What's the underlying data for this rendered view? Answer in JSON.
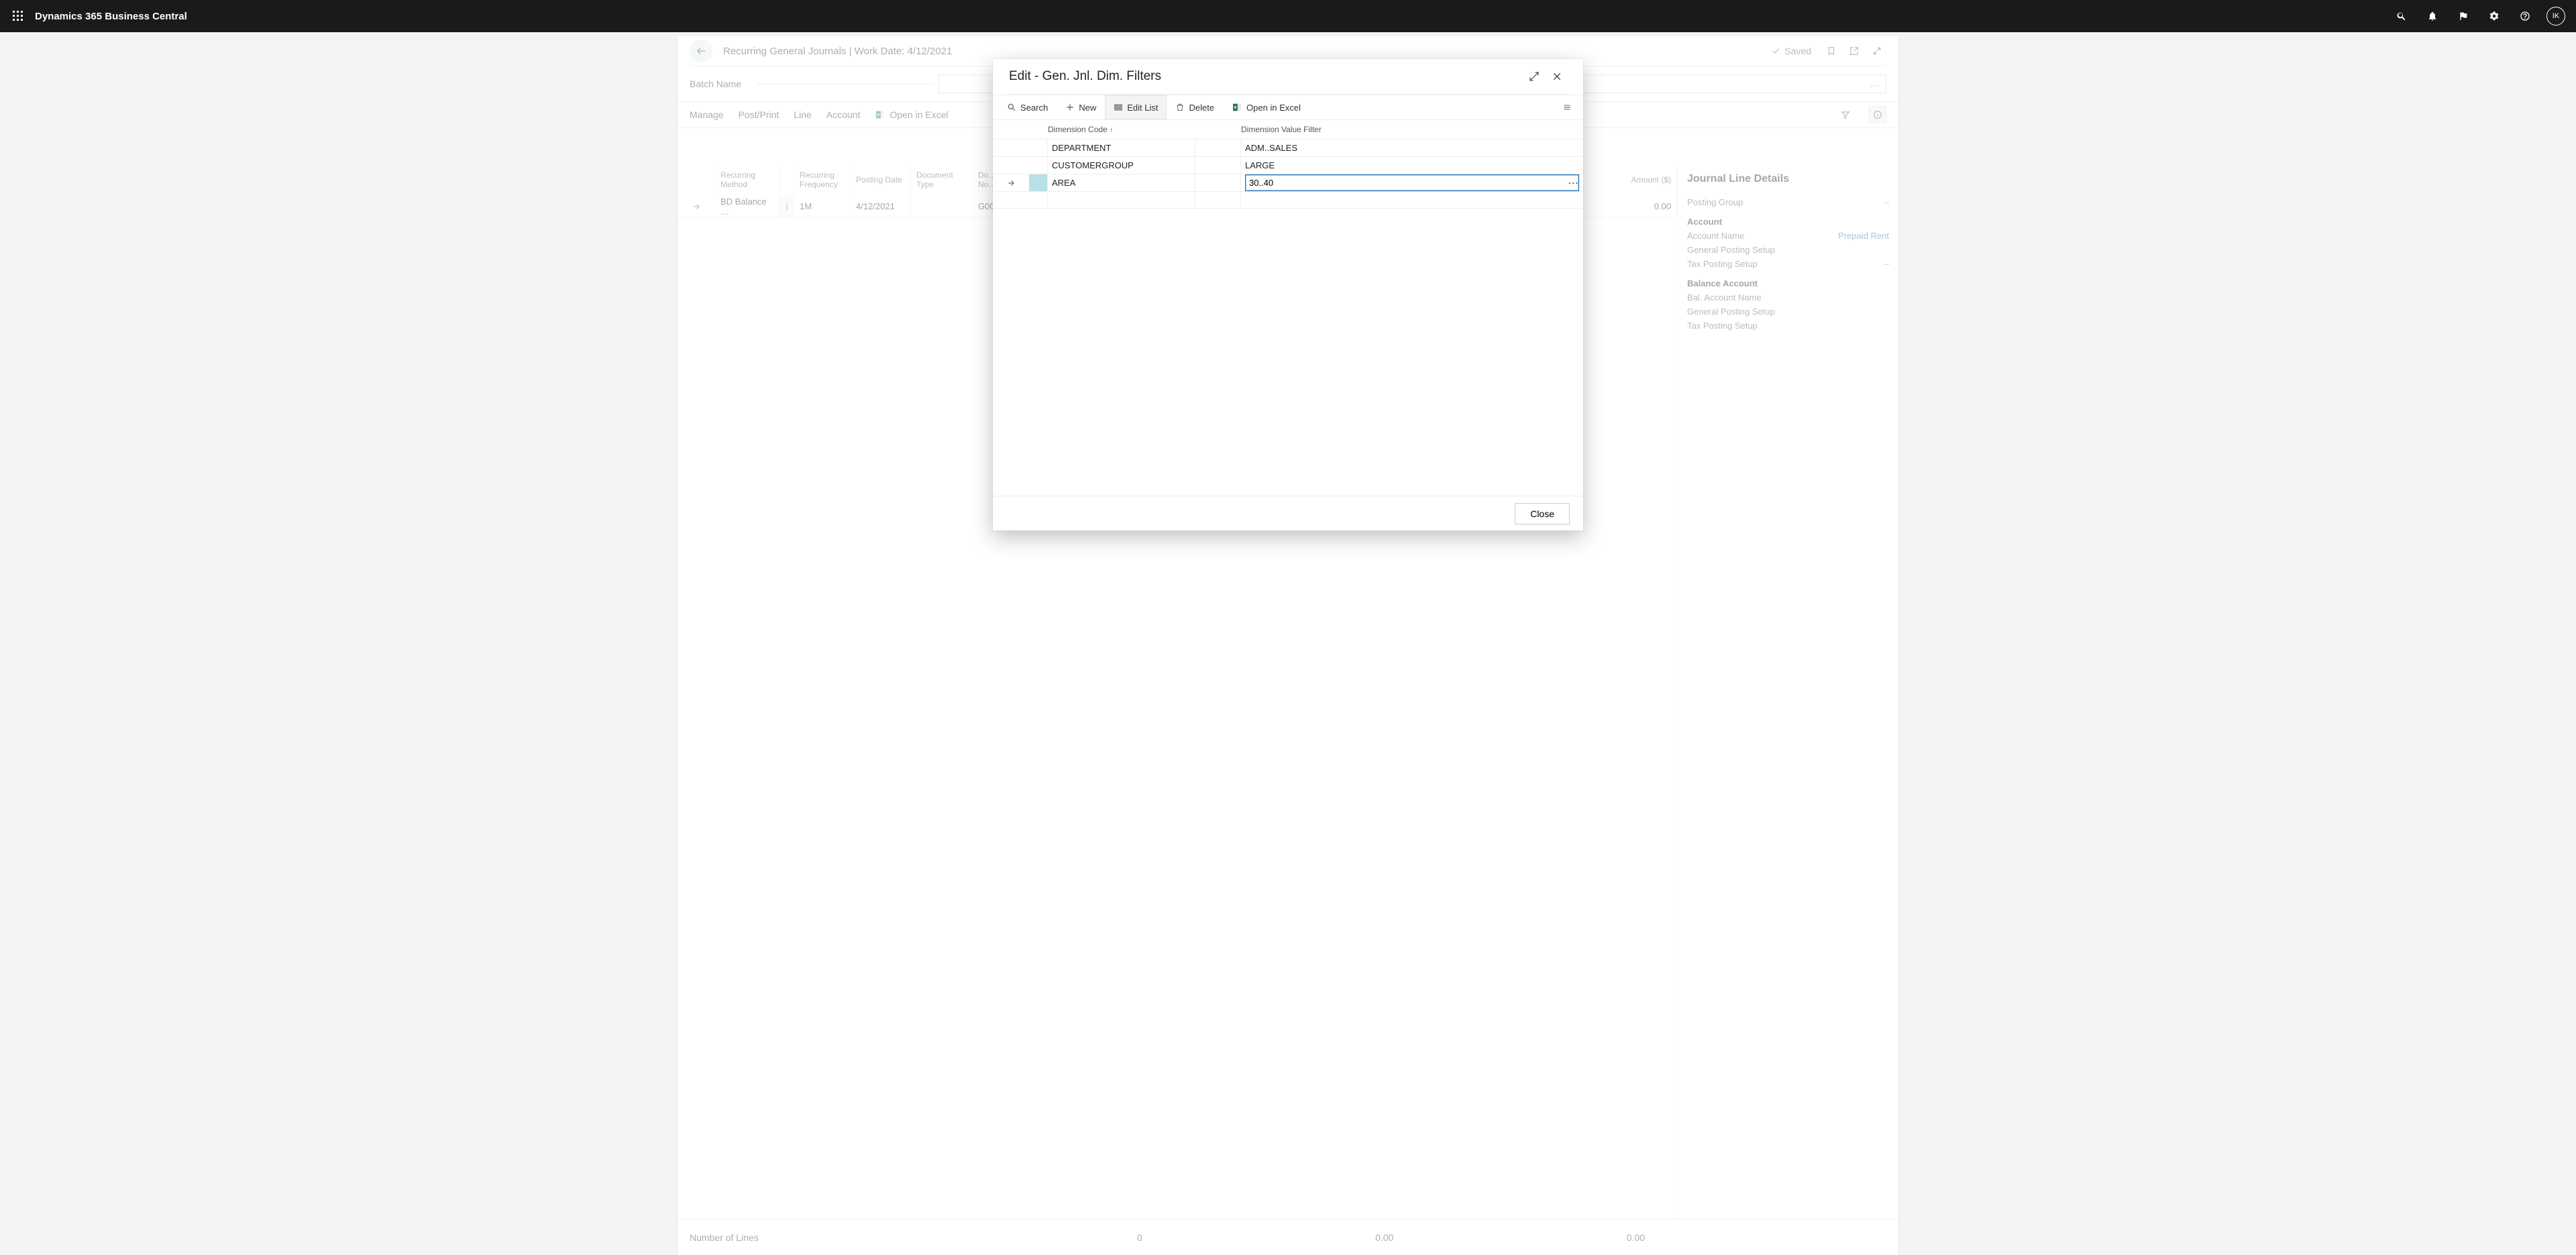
{
  "topbar": {
    "app_title": "Dynamics 365 Business Central",
    "avatar_initials": "IK"
  },
  "page": {
    "breadcrumb": "Recurring General Journals | Work Date: 4/12/2021",
    "saved_label": "Saved",
    "batch_label": "Batch Name"
  },
  "toolbar": {
    "manage": "Manage",
    "postprint": "Post/Print",
    "line": "Line",
    "account": "Account",
    "open_excel": "Open in Excel"
  },
  "grid": {
    "headers": {
      "recurring_method": "Recurring Method",
      "recurring_freq": "Recurring Frequency",
      "posting_date": "Posting Date",
      "document_type": "Document Type",
      "document_no": "Do… No…",
      "amount": "Amount ($)"
    },
    "row": {
      "recurring_method": "BD Balance …",
      "recurring_freq": "1M",
      "posting_date": "4/12/2021",
      "document_type": "",
      "document_no": "G00…",
      "amount": "0.00"
    }
  },
  "details": {
    "title": "Journal Line Details",
    "posting_group": "Posting Group",
    "account_section": "Account",
    "account_name_label": "Account Name",
    "account_name_value": "Prepaid Rent",
    "general_posting_setup": "General Posting Setup",
    "tax_posting_setup": "Tax Posting Setup",
    "balance_section": "Balance Account",
    "bal_account_name": "Bal. Account Name"
  },
  "footer": {
    "label": "Number of Lines",
    "v1": "0",
    "v2": "0.00",
    "v3": "0.00"
  },
  "dialog": {
    "title": "Edit - Gen. Jnl. Dim. Filters",
    "search": "Search",
    "new": "New",
    "edit_list": "Edit List",
    "delete": "Delete",
    "open_excel": "Open in Excel",
    "col_code": "Dimension Code",
    "col_filter": "Dimension Value Filter",
    "rows": [
      {
        "code": "DEPARTMENT",
        "filter": "ADM..SALES"
      },
      {
        "code": "CUSTOMERGROUP",
        "filter": "LARGE"
      },
      {
        "code": "AREA",
        "filter": "30..40"
      }
    ],
    "close": "Close"
  }
}
